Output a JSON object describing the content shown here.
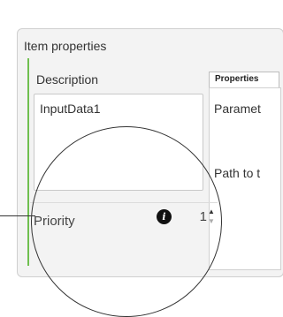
{
  "panel": {
    "title": "Item properties",
    "description_label": "Description",
    "description_value": "InputData1",
    "properties_tab": "Properties",
    "parameter_text": "Paramet",
    "path_text": "Path to t",
    "priority_label": "Priority",
    "priority_value": "1",
    "info_icon_glyph": "i",
    "spin_up": "▲",
    "spin_down": "▼"
  },
  "colors": {
    "accent_green": "#6fbf4f",
    "panel_bg": "#f3f3f3"
  }
}
